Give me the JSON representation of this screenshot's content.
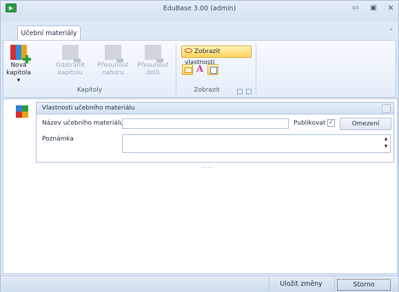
{
  "window": {
    "title": "EduBase 3.00 (admin)",
    "controls": {
      "minimize": "▭",
      "maximize": "▣",
      "close": "✕"
    }
  },
  "ribbon": {
    "tab_label": "Učební materiály",
    "collapse_glyph": "⌃",
    "groups": {
      "chapters_label": "Kapitoly",
      "view_label": "Zobrazit"
    },
    "buttons": {
      "new_chapter": {
        "line1": "Nová",
        "line2": "kapitola ▾"
      },
      "remove_chapter": {
        "line1": "Odstranit",
        "line2": "kapitolu"
      },
      "move_up": {
        "line1": "Přesunout",
        "line2": "nahoru"
      },
      "move_down": {
        "line1": "Přesunout",
        "line2": "dolů"
      },
      "show_properties": "Zobrazit vlastnosti",
      "font_glyph": "A"
    }
  },
  "properties_panel": {
    "header": "Vlastnosti učebního materiálu",
    "name_label": "Název učebního materiálu",
    "name_value": "",
    "publish_label": "Publikovat",
    "publish_checked": "✓",
    "restrictions_button": "Omezení",
    "note_label": "Poznámka",
    "note_value": "",
    "scroll_up": "▲",
    "scroll_down": "▼"
  },
  "splitter_glyph": "⋯⋯",
  "statusbar": {
    "save_button": "Uložit změny",
    "cancel_button": "Storno"
  },
  "colors": {
    "chrome": "#dfe9f5",
    "accent_highlight": "#ffd45c",
    "border": "#a9bcd6"
  }
}
